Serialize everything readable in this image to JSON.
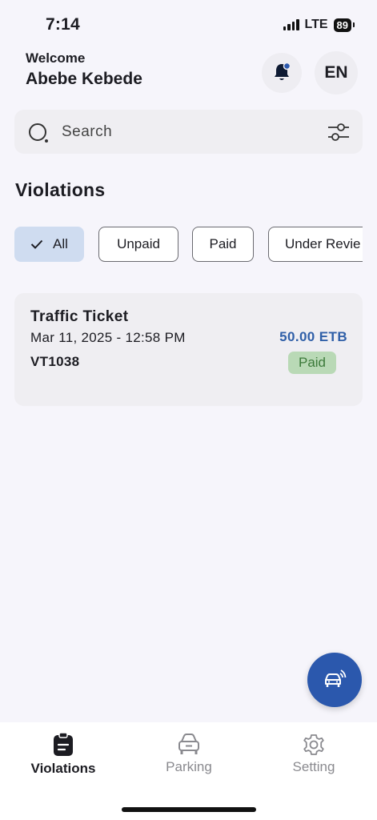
{
  "status_bar": {
    "time": "7:14",
    "network": "LTE",
    "battery": "89"
  },
  "header": {
    "welcome": "Welcome",
    "user_name": "Abebe Kebede",
    "language": "EN"
  },
  "icons": {
    "notification": "bell-icon",
    "search": "search-icon",
    "filter": "sliders-icon",
    "fab": "car-signal-icon"
  },
  "search": {
    "placeholder": "Search"
  },
  "section": {
    "title": "Violations"
  },
  "filters": [
    {
      "label": "All",
      "selected": true
    },
    {
      "label": "Unpaid",
      "selected": false
    },
    {
      "label": "Paid",
      "selected": false
    },
    {
      "label": "Under Revie",
      "selected": false
    }
  ],
  "violations": [
    {
      "title": "Traffic Ticket",
      "date": "Mar 11, 2025 - 12:58 PM",
      "code": "VT1038",
      "amount": "50.00 ETB",
      "status": "Paid"
    }
  ],
  "bottom_nav": [
    {
      "label": "Violations",
      "icon": "clipboard-icon",
      "active": true
    },
    {
      "label": "Parking",
      "icon": "car-icon",
      "active": false
    },
    {
      "label": "Setting",
      "icon": "gear-icon",
      "active": false
    }
  ],
  "colors": {
    "accent": "#2b58ad",
    "selected_chip": "#cfdcf0",
    "paid_badge_bg": "#b9d9b6",
    "paid_badge_text": "#3c7a3a",
    "amount": "#2f5fa8"
  }
}
